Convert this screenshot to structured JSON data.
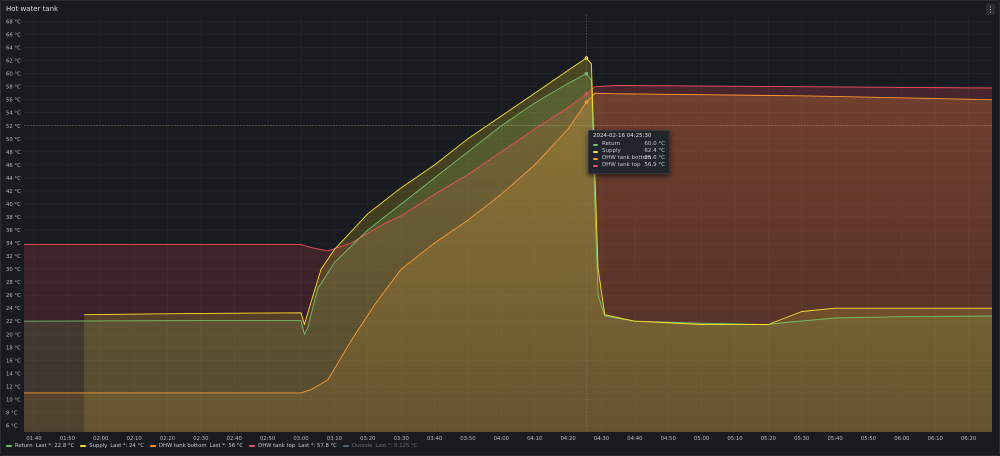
{
  "panel": {
    "title": "Hot water tank",
    "menu_icon": "kebab-menu-icon"
  },
  "tooltip": {
    "time": "2024-02-16 04:25:30",
    "rows": [
      {
        "name": "Return",
        "value": "60.0 °C",
        "color": "#73bf69"
      },
      {
        "name": "Supply",
        "value": "62.4 °C",
        "color": "#fade2a"
      },
      {
        "name": "DHW tank bottom",
        "value": "55.6 °C",
        "color": "#ff9830"
      },
      {
        "name": "DHW tank top",
        "value": "56.9 °C",
        "color": "#f2495c"
      }
    ]
  },
  "legend": [
    {
      "name": "Return",
      "last": "Last *: 22.8 °C",
      "color": "#73bf69"
    },
    {
      "name": "Supply",
      "last": "Last *: 24 °C",
      "color": "#fade2a"
    },
    {
      "name": "DHW tank bottom",
      "last": "Last *: 56 °C",
      "color": "#ff9830"
    },
    {
      "name": "DHW tank top",
      "last": "Last *: 57.8 °C",
      "color": "#f2495c"
    },
    {
      "name": "Outside",
      "last": "Last *: 0.125 °C",
      "color": "#8ab8ff",
      "hidden": true
    }
  ],
  "chart_data": {
    "type": "line",
    "unit": "°C",
    "ylim": [
      5,
      69
    ],
    "yticks": [
      6,
      8,
      10,
      12,
      14,
      16,
      18,
      20,
      22,
      24,
      26,
      28,
      30,
      32,
      34,
      36,
      38,
      40,
      42,
      44,
      46,
      48,
      50,
      52,
      54,
      56,
      58,
      60,
      62,
      64,
      66,
      68
    ],
    "xlim": [
      "01:37",
      "06:27"
    ],
    "xticks": [
      "01:40",
      "01:50",
      "02:00",
      "02:10",
      "02:20",
      "02:30",
      "02:40",
      "02:50",
      "03:00",
      "03:10",
      "03:20",
      "03:30",
      "03:40",
      "03:50",
      "04:00",
      "04:10",
      "04:20",
      "04:30",
      "04:40",
      "04:50",
      "05:00",
      "05:10",
      "05:20",
      "05:30",
      "05:40",
      "05:50",
      "06:00",
      "06:10",
      "06:20"
    ],
    "threshold": 52,
    "hover_time": "04:25:30",
    "series": [
      {
        "name": "DHW tank top",
        "color": "#f2495c",
        "points": [
          [
            "01:37",
            33.8
          ],
          [
            "03:00",
            33.8
          ],
          [
            "03:03",
            33.3
          ],
          [
            "03:08",
            32.8
          ],
          [
            "03:15",
            34
          ],
          [
            "03:25",
            37
          ],
          [
            "03:30",
            38.2
          ],
          [
            "03:40",
            41.5
          ],
          [
            "03:50",
            44.5
          ],
          [
            "04:00",
            48
          ],
          [
            "04:10",
            51.5
          ],
          [
            "04:20",
            54.8
          ],
          [
            "04:25:30",
            56.9
          ],
          [
            "04:28",
            58
          ],
          [
            "04:35",
            58.2
          ],
          [
            "05:30",
            58
          ],
          [
            "06:27",
            57.8
          ]
        ]
      },
      {
        "name": "DHW tank bottom",
        "color": "#ff9830",
        "points": [
          [
            "01:37",
            11
          ],
          [
            "03:00",
            11
          ],
          [
            "03:03",
            11.5
          ],
          [
            "03:08",
            13
          ],
          [
            "03:15",
            19
          ],
          [
            "03:22",
            24.5
          ],
          [
            "03:30",
            30
          ],
          [
            "03:40",
            34
          ],
          [
            "03:50",
            37.5
          ],
          [
            "04:00",
            41.5
          ],
          [
            "04:10",
            46
          ],
          [
            "04:20",
            51.5
          ],
          [
            "04:25:30",
            55.6
          ],
          [
            "04:28",
            57
          ],
          [
            "04:35",
            56.9
          ],
          [
            "05:30",
            56.6
          ],
          [
            "06:27",
            56
          ]
        ]
      },
      {
        "name": "Return",
        "color": "#73bf69",
        "points": [
          [
            "01:37",
            22
          ],
          [
            "02:30",
            22.1
          ],
          [
            "03:00",
            22.1
          ],
          [
            "03:01",
            20
          ],
          [
            "03:02",
            21
          ],
          [
            "03:05",
            27
          ],
          [
            "03:10",
            31
          ],
          [
            "03:20",
            36
          ],
          [
            "03:30",
            40
          ],
          [
            "03:40",
            44
          ],
          [
            "03:50",
            48
          ],
          [
            "04:00",
            52
          ],
          [
            "04:10",
            55.5
          ],
          [
            "04:20",
            58.5
          ],
          [
            "04:25:30",
            60
          ],
          [
            "04:27",
            59
          ],
          [
            "04:28",
            40
          ],
          [
            "04:29",
            26
          ],
          [
            "04:31",
            22.8
          ],
          [
            "04:40",
            22
          ],
          [
            "05:00",
            21.7
          ],
          [
            "05:20",
            21.5
          ],
          [
            "05:25",
            21.8
          ],
          [
            "05:40",
            22.5
          ],
          [
            "06:00",
            22.7
          ],
          [
            "06:27",
            22.8
          ]
        ]
      },
      {
        "name": "Supply",
        "color": "#fade2a",
        "points": [
          [
            "01:55",
            23
          ],
          [
            "02:30",
            23.2
          ],
          [
            "03:00",
            23.3
          ],
          [
            "03:01",
            21.5
          ],
          [
            "03:03",
            25
          ],
          [
            "03:06",
            30
          ],
          [
            "03:10",
            33
          ],
          [
            "03:20",
            38.5
          ],
          [
            "03:30",
            42.5
          ],
          [
            "03:40",
            46
          ],
          [
            "03:50",
            50
          ],
          [
            "04:00",
            53.5
          ],
          [
            "04:10",
            57
          ],
          [
            "04:20",
            60.5
          ],
          [
            "04:25:30",
            62.4
          ],
          [
            "04:27",
            61.5
          ],
          [
            "04:28",
            45
          ],
          [
            "04:29",
            30
          ],
          [
            "04:31",
            23
          ],
          [
            "04:40",
            22
          ],
          [
            "05:00",
            21.5
          ],
          [
            "05:20",
            21.5
          ],
          [
            "05:25",
            22.5
          ],
          [
            "05:30",
            23.5
          ],
          [
            "05:40",
            24
          ],
          [
            "06:27",
            24
          ]
        ]
      }
    ]
  }
}
